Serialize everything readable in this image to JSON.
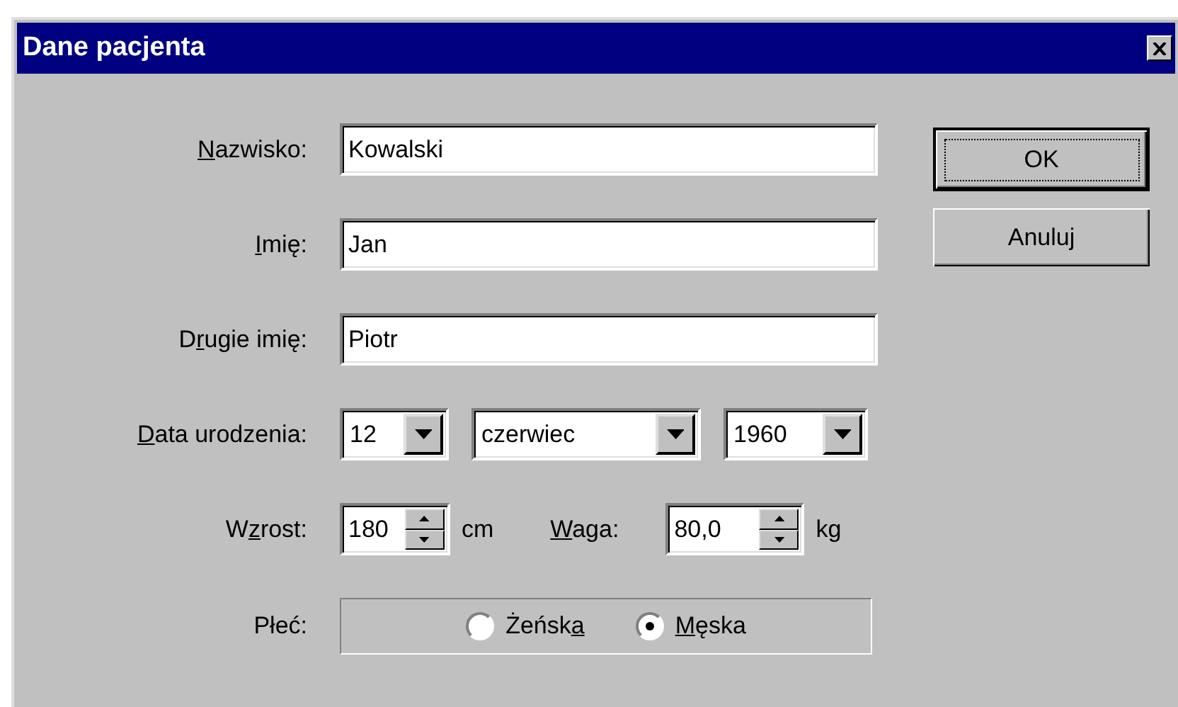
{
  "window": {
    "title": "Dane pacjenta"
  },
  "fields": [
    {
      "label": [
        {
          "text": "N",
          "accel": true
        },
        {
          "text": "azwisko:",
          "accel": false
        }
      ],
      "value": "Kowalski"
    },
    {
      "label": [
        {
          "text": "I",
          "accel": true
        },
        {
          "text": "mię:",
          "accel": false
        }
      ],
      "value": "Jan"
    },
    {
      "label": [
        {
          "text": "D",
          "accel": false
        },
        {
          "text": "r",
          "accel": true
        },
        {
          "text": "ugie imię:",
          "accel": false
        }
      ],
      "value": "Piotr"
    }
  ],
  "birth_date": {
    "label": [
      {
        "text": "D",
        "accel": true
      },
      {
        "text": "ata urodzenia:",
        "accel": false
      }
    ],
    "day": "12",
    "month": "czerwiec",
    "year": "1960"
  },
  "height": {
    "label": [
      {
        "text": "W",
        "accel": false
      },
      {
        "text": "z",
        "accel": true
      },
      {
        "text": "rost:",
        "accel": false
      }
    ],
    "value": "180",
    "unit": "cm"
  },
  "weight": {
    "label": [
      {
        "text": "W",
        "accel": true
      },
      {
        "text": "aga:",
        "accel": false
      }
    ],
    "value": "80,0",
    "unit": "kg"
  },
  "sex": {
    "label": [
      {
        "text": "Płeć:",
        "accel": false
      }
    ],
    "options": [
      {
        "label": [
          {
            "text": "Żeńsk",
            "accel": false
          },
          {
            "text": "a",
            "accel": true
          }
        ],
        "selected": false
      },
      {
        "label": [
          {
            "text": "M",
            "accel": true
          },
          {
            "text": "ęska",
            "accel": false
          }
        ],
        "selected": true
      }
    ]
  },
  "buttons": [
    {
      "label": "OK",
      "default": true
    },
    {
      "label": "Anuluj",
      "default": false
    }
  ]
}
